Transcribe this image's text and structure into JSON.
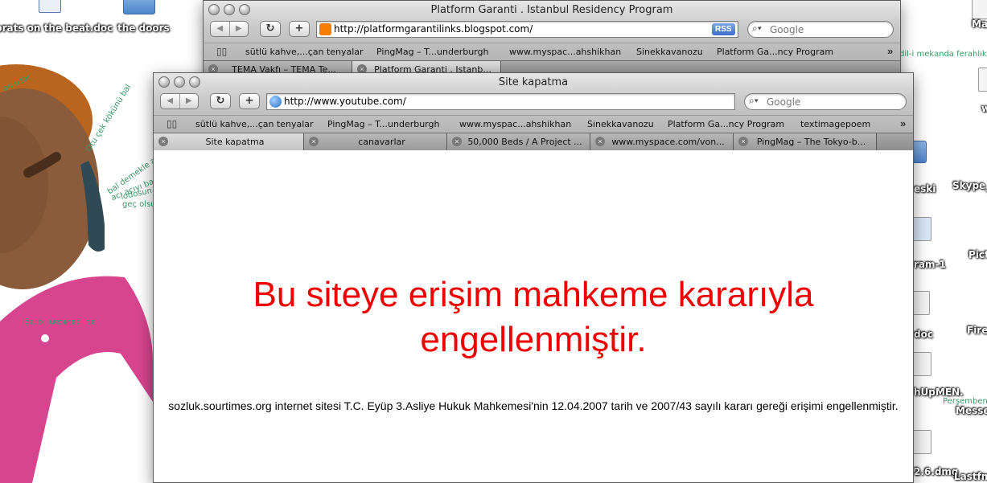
{
  "desktop": {
    "colors": {
      "pink_shirt": "#d7458f",
      "skin": "#8a5c3b",
      "hair": "#b9651f",
      "phone": "#2f4a55",
      "wall_text": "#3a9a6a"
    },
    "icons": [
      {
        "label": "brats on the beat.doc",
        "icon": "word-document-icon"
      },
      {
        "label": "the doors",
        "icon": "folder-icon"
      },
      {
        "label": "Ma",
        "icon": "document-icon"
      },
      {
        "label": "eski",
        "icon": "folder-icon"
      },
      {
        "label": "Skype_",
        "icon": "disk-image-icon"
      },
      {
        "label": "ram-1",
        "icon": "application-icon"
      },
      {
        "label": "Pictu",
        "icon": "folder-icon"
      },
      {
        "label": "doc",
        "icon": "document-icon"
      },
      {
        "label": "Fire",
        "icon": "application-icon"
      },
      {
        "label": "hUpMEN.",
        "icon": "document-icon"
      },
      {
        "label": "Messe",
        "icon": "document-icon"
      },
      {
        "label": "2.6.dmg",
        "icon": "disk-image-icon"
      },
      {
        "label": "Lastfm",
        "icon": "disk-image-icon"
      },
      {
        "label": "w",
        "icon": "document-icon"
      }
    ],
    "wallpaper_text": [
      "dil-i mekanda ferahlık va",
      "an uzar",
      "Otu çek kökünü bal",
      "bal demekle ağ",
      "acı acıyı bastır",
      "lodosun",
      "geç olsu",
      "acı patlıcanı kırağ",
      "Perşembenin"
    ]
  },
  "back_window": {
    "title": "Platform Garanti . Istanbul Residency Program",
    "url": "http://platformgarantilinks.blogspot.com/",
    "rss_label": "RSS",
    "search_placeholder": "Google",
    "bookmarks": [
      "sütlü kahve,...çan tenyalar",
      "PingMag – T...underburgh",
      "www.myspac...ahshikhan",
      "Sinekkavanozu",
      "Platform Ga...ncy Program"
    ],
    "tabs": [
      "TEMA Vakfı – TEMA Te...",
      "Platform Garanti . Istanb..."
    ]
  },
  "front_window": {
    "title": "Site kapatma",
    "url": "http://www.youtube.com/",
    "search_placeholder": "Google",
    "bookmarks": [
      "sütlü kahve,...çan tenyalar",
      "PingMag – T...underburgh",
      "www.myspac...ahshikhan",
      "Sinekkavanozu",
      "Platform Ga...ncy Program",
      "textimagepoem"
    ],
    "tabs": [
      "Site kapatma",
      "canavarlar",
      "50,000 Beds / A Project ...",
      "www.myspace.com/von...",
      "PingMag – The Tokyo-b..."
    ],
    "active_tab_index": 0,
    "page": {
      "heading": "Bu siteye erişim mahkeme kararıyla engellenmiştir.",
      "detail": "sozluk.sourtimes.org internet sitesi T.C. Eyüp 3.Asliye Hukuk Mahkemesi'nin 12.04.2007 tarih ve 2007/43 sayılı kararı gereği erişimi engellenmiştir.",
      "heading_color": "#ee0000"
    }
  }
}
